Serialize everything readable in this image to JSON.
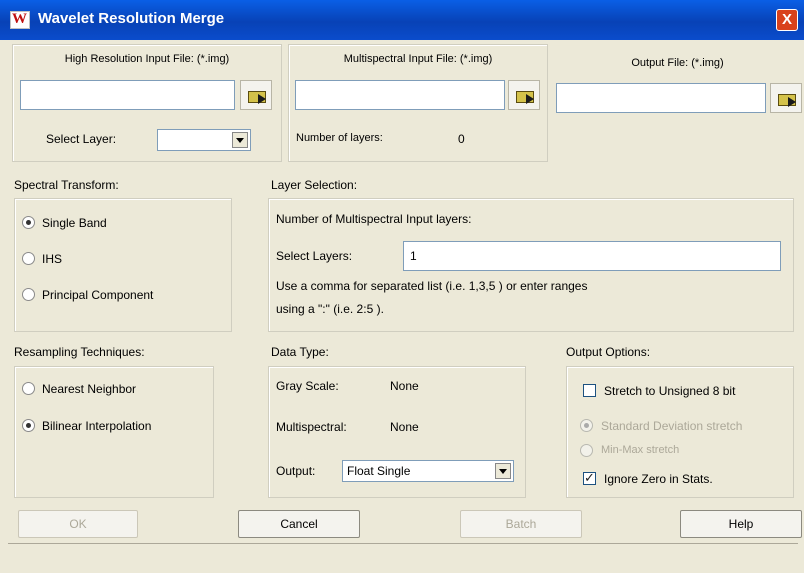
{
  "window": {
    "title": "Wavelet Resolution Merge",
    "close_glyph": "X"
  },
  "high_res": {
    "label": "High Resolution Input File: (*.img)",
    "value": "",
    "select_layer_label": "Select Layer:",
    "select_layer_value": ""
  },
  "multispectral": {
    "label": "Multispectral Input File: (*.img)",
    "value": "",
    "num_layers_label": "Number of layers:",
    "num_layers_value": "0"
  },
  "output_file": {
    "label": "Output File: (*.img)",
    "value": ""
  },
  "spectral_transform": {
    "label": "Spectral Transform:",
    "options": [
      "Single Band",
      "IHS",
      "Principal Component"
    ],
    "selected": "Single Band"
  },
  "layer_selection": {
    "label": "Layer Selection:",
    "info": "Number of Multispectral Input layers:",
    "select_layers_label": "Select Layers:",
    "select_layers_value": "1",
    "hint_line1": "Use a comma for separated list (i.e. 1,3,5 ) or enter ranges",
    "hint_line2": "using a \":\" (i.e. 2:5 )."
  },
  "resampling": {
    "label": "Resampling Techniques:",
    "options": [
      "Nearest Neighbor",
      "Bilinear Interpolation"
    ],
    "selected": "Bilinear Interpolation"
  },
  "data_type": {
    "label": "Data Type:",
    "gray_label": "Gray Scale:",
    "gray_value": "None",
    "multi_label": "Multispectral:",
    "multi_value": "None",
    "output_label": "Output:",
    "output_value": "Float Single"
  },
  "output_options": {
    "label": "Output Options:",
    "stretch_label": "Stretch to Unsigned 8 bit",
    "stretch_checked": false,
    "std_dev_label": "Standard Deviation stretch",
    "minmax_label": "Min-Max stretch",
    "ignore_zero_label": "Ignore Zero in Stats.",
    "ignore_zero_checked": true
  },
  "buttons": {
    "ok": "OK",
    "cancel": "Cancel",
    "batch": "Batch",
    "help": "Help"
  },
  "icons": {
    "app": "erdas-app-icon",
    "close": "close-icon",
    "browse": "folder-browse-icon",
    "dropdown": "chevron-down-icon"
  },
  "colors": {
    "titlebar": "#0a50d8",
    "face": "#ece9d8",
    "close": "#d9421c"
  }
}
